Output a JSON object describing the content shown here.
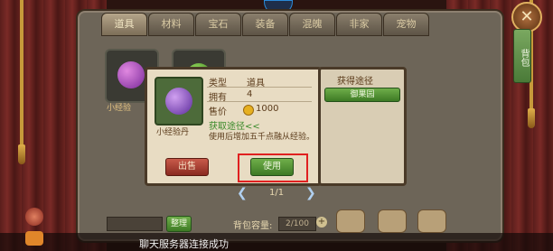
{
  "tabs": [
    "道具",
    "材料",
    "宝石",
    "装备",
    "混魄",
    "非家",
    "宠物"
  ],
  "active_tab_index": 0,
  "left_slot_label": "小经验",
  "item": {
    "name": "小经验丹",
    "type_label": "类型",
    "type_value": "道具",
    "owned_label": "拥有",
    "owned_value": "4",
    "price_label": "售价",
    "price_value": "1000",
    "get_route_link": "获取途径<<",
    "description": "使用后增加五千点融从经验。",
    "sell_button": "出售",
    "use_button": "使用"
  },
  "route_panel": {
    "title": "获得途径",
    "entry": "御果园"
  },
  "pagination": {
    "current": "1/1"
  },
  "bottom": {
    "sort_button": "整理",
    "capacity_label": "背包容量:",
    "capacity_value": "2/100"
  },
  "backpack_tab_label": "背包",
  "close_icon": "✕",
  "chat_status": "聊天服务器连接成功",
  "colors": {
    "highlight_box": "#e02020",
    "accent_gold": "#c79a3a"
  }
}
